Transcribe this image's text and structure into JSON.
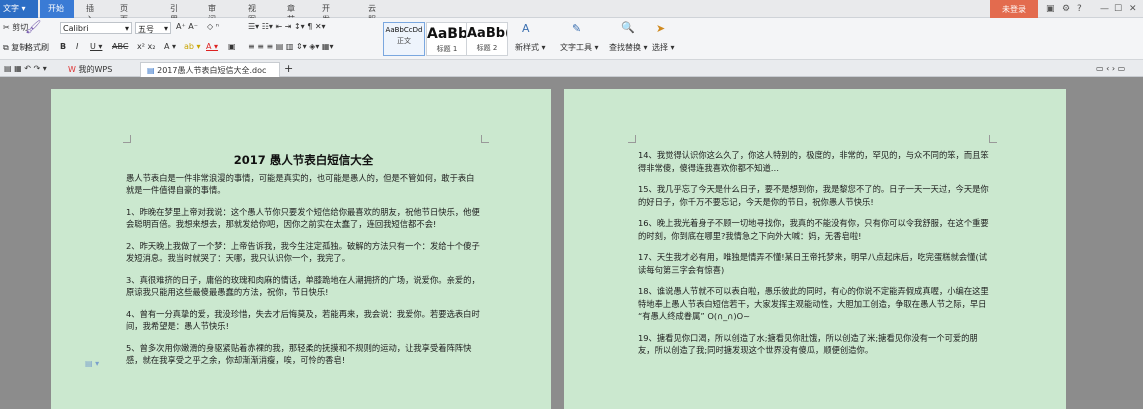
{
  "titlebar": {
    "app_menu": "文字",
    "tabs": [
      "开始",
      "插入",
      "页面布局",
      "引用",
      "审阅",
      "视图",
      "章节",
      "开发工具",
      "云服务"
    ],
    "login": "未登录"
  },
  "ribbon": {
    "cut": "剪切",
    "copy": "复制",
    "format_painter": "格式刷",
    "paste": "粘贴",
    "font_name": "Calibri",
    "font_size": "五号",
    "styles": [
      {
        "preview": "AaBbCcDd",
        "label": "正文"
      },
      {
        "preview": "AaBb",
        "label": "标题 1"
      },
      {
        "preview": "AaBb(",
        "label": "标题 2"
      }
    ],
    "new_style": "新样式",
    "text_tools": "文字工具",
    "find_replace": "查找替换",
    "select": "选择"
  },
  "doc_tabs": {
    "mywps": "我的WPS",
    "file": "2017愚人节表白短信大全.doc"
  },
  "left_page": {
    "title": "2017 愚人节表白短信大全",
    "paragraphs": [
      "愚人节表白是一件非常浪漫的事情，可能是真实的，也可能是愚人的，但是不管如何，敢于表白就是一件值得自豪的事情。",
      "1、昨晚在梦里上帝对我说：这个愚人节你只要发个短信给你最喜欢的朋友，祝他节日快乐，他便会聪明百倍。我想来想去，那就发给你吧，因你之前实在太蠢了，连回我短信都不会!",
      "2、昨天晚上我做了一个梦：上帝告诉我，我今生注定孤独。破解的方法只有一个：发给十个傻子发短消息。我当时就哭了：天哪，我只认识你一个，我完了。",
      "3、真很难挤的日子，庸俗的玫瑰和肉麻的情话，单膝跪地在人潮拥挤的广场，说爱你。亲爱的，原谅我只能用这些最傻最愚蠢的方法，祝你，节日快乐!",
      "4、曾有一分真挚的爱，我没珍惜，失去才后悔莫及，若能再来，我会说：我爱你。若要选表白时间，我希望是：愚人节快乐!",
      "5、曾多次用你嫩滑的身驱紧贴着赤裸的我，那轻柔的抚摸和不规则的运动，让我享受着阵阵快感，就在我享受之乎之余，你却渐渐消瘦，唉，可怜的香皂!"
    ]
  },
  "right_page": {
    "paragraphs": [
      "14、我觉得认识你这么久了，你这人特别的，极度的，非常的，罕见的，与众不同的笨，而且笨得非常傻，傻得连我喜欢你都不知道…",
      "15、我几乎忘了今天是什么日子，要不是想到你，我是黎您不了的。日子一天一天过，今天是你的好日子，你千万不要忘记，今天是你的节日，祝你愚人节快乐!",
      "16、晚上我光着身子不顾一切地寻找你，我真的不能没有你，只有你可以令我舒服，在这个重要的时刻，你到底在哪里?我情急之下向外大喊：妈，无香皂啦!",
      "17、天生我才必有用，唯独是情弄不懂!某日王帝托梦来，明早八点起床后，吃完蛋糕就会懂(试读每句第三字会有惊喜)",
      "18、谁说愚人节就不可以表白啦，愚乐彼此的同时，有心的你说不定能弄假成真喔，小编在这里特地奉上愚人节表白短信若干，大家发挥主观能动性，大胆加工创造，争取在愚人节之际，早日 “有愚人终成眷属” O(∩_∩)O~",
      "19、搪看见你口渴，所以创造了水;搪看见你肚饿，所以创造了米;搪看见你没有一个可爱的朋友，所以创造了我;同时搪发现这个世界没有傻瓜，顺便创造你。"
    ]
  },
  "colors": {
    "page": "#cbe8cf",
    "active_tab": "#3a7bd5",
    "login": "#e36b4e",
    "background": "#8c8c8c"
  }
}
